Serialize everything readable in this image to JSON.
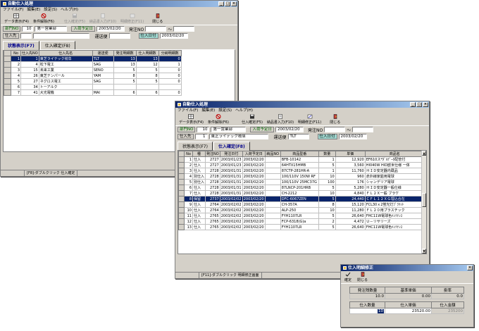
{
  "window1": {
    "title": "自動仕入処理",
    "menu": [
      "ファイル(F)",
      "編集(E)",
      "設定(S)",
      "ヘルプ(H)"
    ],
    "toolbar": [
      {
        "label": "データ表示(F4)",
        "icon": "table-icon",
        "enabled": true
      },
      {
        "label": "条件解除(F6)",
        "icon": "cancel-icon",
        "enabled": true
      },
      {
        "label": "仕入確定(F5)",
        "icon": "disk-icon",
        "enabled": false
      },
      {
        "label": "納品書入力(F10)",
        "icon": "document-icon",
        "enabled": false
      },
      {
        "label": "明細修正(F11)",
        "icon": "edit-icon",
        "enabled": false
      },
      {
        "label": "閉じる",
        "icon": "exit-icon",
        "enabled": true
      }
    ],
    "dept_label": "部門NO",
    "dept_no": "10",
    "dept_name": "第一営業部",
    "arrival_label": "入荷予定日",
    "arrival_date": "2003/02/20",
    "order_no_label": "発注NO",
    "tilde": "～",
    "supplier_label": "仕入先",
    "transport_label": "運送便",
    "pur_date_label": "仕入日付",
    "pur_date": "2003/02/20",
    "tabs": [
      "状態表示(F7)",
      "仕入確定(F8)"
    ],
    "columns": [
      "No",
      "仕入先NO",
      "仕入先名",
      "運送便",
      "発注明細数",
      "仕入明細数",
      "分納明細数"
    ],
    "rows": [
      [
        "1",
        "1",
        "東芝ライテック岐阜",
        "TLT",
        "13",
        "13",
        "0"
      ],
      [
        "2",
        "4",
        "松下電工",
        "SAG",
        "13",
        "12",
        "1"
      ],
      [
        "3",
        "15",
        "未来工業",
        "SENO",
        "5",
        "5",
        "0"
      ],
      [
        "4",
        "26",
        "東芝テンパール",
        "YAM",
        "8",
        "8",
        "0"
      ],
      [
        "5",
        "27",
        "ネグロス電工",
        "SAG",
        "5",
        "5",
        "0"
      ],
      [
        "6",
        "34",
        "トーアルク",
        "",
        "",
        "",
        ""
      ],
      [
        "7",
        "41",
        "大光電機",
        "MAI",
        "6",
        "6",
        "0"
      ]
    ],
    "status": [
      "[F8]-ダブルクリック",
      "仕入確定"
    ]
  },
  "window2": {
    "title": "自動仕入処理",
    "menu": [
      "ファイル(F)",
      "編集(E)",
      "設定(S)",
      "ヘルプ(H)"
    ],
    "toolbar": [
      {
        "label": "データ表示(F4)",
        "icon": "table-icon",
        "enabled": true
      },
      {
        "label": "条件解除(F6)",
        "icon": "cancel-icon",
        "enabled": true
      },
      {
        "label": "仕入確定(F5)",
        "icon": "disk-icon",
        "enabled": true
      },
      {
        "label": "納品書入力(F10)",
        "icon": "document-icon",
        "enabled": true
      },
      {
        "label": "明細修正(F11)",
        "icon": "edit-icon",
        "enabled": true
      },
      {
        "label": "閉じる",
        "icon": "exit-icon",
        "enabled": true
      }
    ],
    "dept_label": "部門NO",
    "dept_no": "10",
    "dept_name": "第一営業部",
    "arrival_label": "入荷予定日",
    "arrival_date": "2003/02/20",
    "order_no_label": "発注NO",
    "tilde": "～",
    "supplier_label": "仕入先",
    "supplier_no": "1",
    "supplier_name": "東芝ライテック岐阜",
    "transport_label": "運送便",
    "transport": "TLT",
    "pur_date_label": "仕入日付",
    "pur_date": "2003/02/20",
    "tabs": [
      "状態表示(F7)",
      "仕入確定(F8)"
    ],
    "columns": [
      "No",
      "種",
      "発注NO",
      "発注日付",
      "入荷予定日",
      "納品NO",
      "商品型番",
      "数量",
      "単価",
      "商品名"
    ],
    "rows": [
      [
        "1",
        "仕入",
        "2727",
        "2003/01/23",
        "2003/02/20",
        "",
        "BFB-10142",
        "1",
        "12,920",
        "EF610ス*ﾀﾞﾙﾃﾞｰﾀ配管付"
      ],
      [
        "2",
        "仕入",
        "2727",
        "2003/01/23",
        "2003/02/20",
        "",
        "64HTX15HMB",
        "5",
        "3,560",
        "HI040W HID欧米仕様 一体"
      ],
      [
        "3",
        "仕入",
        "2728",
        "2003/01/31",
        "2003/02/20",
        "",
        "87CTP-281HR-A",
        "1",
        "11,760",
        "ＨＩＤ安定器内蔵品"
      ],
      [
        "4",
        "別仕入",
        "2728",
        "2003/01/31",
        "2003/02/20",
        "",
        "100/110V 150W RF",
        "10",
        "960",
        "赤外線家庭用電球"
      ],
      [
        "5",
        "別仕入",
        "2728",
        "2003/01/31",
        "2003/02/20",
        "",
        "100/110V 25MC37G",
        "100",
        "176",
        "シャンデリア電球"
      ],
      [
        "6",
        "仕入",
        "2728",
        "2003/01/31",
        "2003/02/20",
        "",
        "87LNCP-201HRB",
        "5",
        "5,280",
        "ＨＩＤ安定器一般仕様"
      ],
      [
        "7",
        "仕入",
        "2728",
        "2003/01/31",
        "2003/02/20",
        "",
        "CH-2212",
        "10",
        "4,840",
        "ＦＬ２Ｘ一般 ブラケ"
      ],
      [
        "8",
        "保留",
        "2737",
        "2003/02/02",
        "2003/02/20",
        "",
        "DFC-6067ZEN",
        "5",
        "24,440",
        "ＣＦＬ１２ＸＧ埋込合在"
      ],
      [
        "9",
        "仕入",
        "2764",
        "2003/02/02",
        "2003/02/20",
        "",
        "CH-357A",
        "8",
        "15,120",
        "FCL30ｘ2蛍光灯ﾌﾞﾗｹｯﾄ"
      ],
      [
        "10",
        "仕入",
        "2764",
        "2003/02/02",
        "2003/02/20",
        "",
        "ALP-250",
        "10",
        "11,280",
        "ＦＬ２０用プラスチック"
      ],
      [
        "11",
        "仕入",
        "2765",
        "2003/02/02",
        "2003/02/20",
        "",
        "FYH1107LR",
        "5",
        "26,640",
        "FHC11W電球色ﾒﾝﾃﾅﾝｽ"
      ],
      [
        "12",
        "仕入",
        "2765",
        "2003/02/02",
        "2003/02/20",
        "",
        "FCP-6318(G)a",
        "2",
        "4,472",
        "Ｕ－リサリーズ"
      ],
      [
        "13",
        "仕入",
        "2765",
        "2003/02/02",
        "2003/02/20",
        "",
        "FYH1107LR",
        "5",
        "26,640",
        "FHC11W電球色ﾒﾝﾃﾅﾝｽ"
      ]
    ],
    "selected_row": 7,
    "status": [
      "[F11]-ダブルクリック",
      "明細修正画面"
    ]
  },
  "dialog": {
    "title": "仕入明細修正",
    "toolbar": [
      {
        "label": "確定",
        "icon": "confirm-icon"
      },
      {
        "label": "閉じる",
        "icon": "exit-icon"
      }
    ],
    "row1_headers": [
      "発注残数量",
      "基準単価",
      "掛率"
    ],
    "row1_values": [
      "10.0",
      "0.00",
      "0.0"
    ],
    "row2_headers": [
      "仕入数量",
      "仕入単価",
      "仕入金額"
    ],
    "row2_values": [
      "10",
      "23520.00",
      "235200"
    ]
  }
}
